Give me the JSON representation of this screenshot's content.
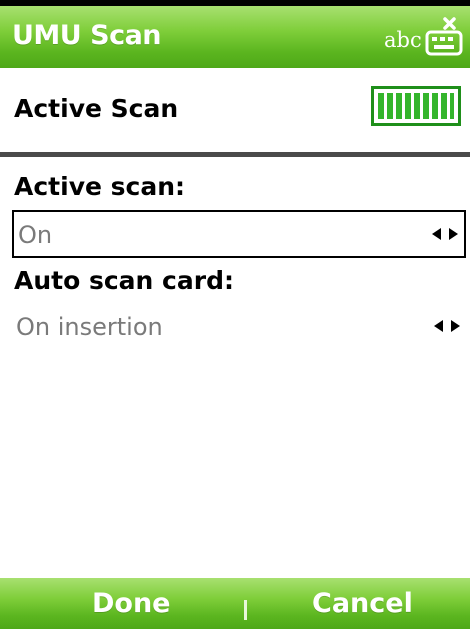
{
  "titlebar": {
    "title": "UMU Scan",
    "input_mode_label": "abc",
    "input_mode_icon": "keyboard-input-icon",
    "color": "#7fce3a"
  },
  "header": {
    "title": "Active Scan",
    "status_icon": "battery-icon",
    "battery_level": 1.0,
    "battery_color": "#34b52c"
  },
  "settings": [
    {
      "label": "Active scan:",
      "value": "On",
      "focused": true
    },
    {
      "label": "Auto scan card:",
      "value": "On insertion",
      "focused": false
    }
  ],
  "softkeys": {
    "left": "Done",
    "right": "Cancel"
  },
  "colors": {
    "accent_green": "#5bb51f",
    "divider": "#4a4a4a",
    "value_text": "#7a7a7a"
  }
}
